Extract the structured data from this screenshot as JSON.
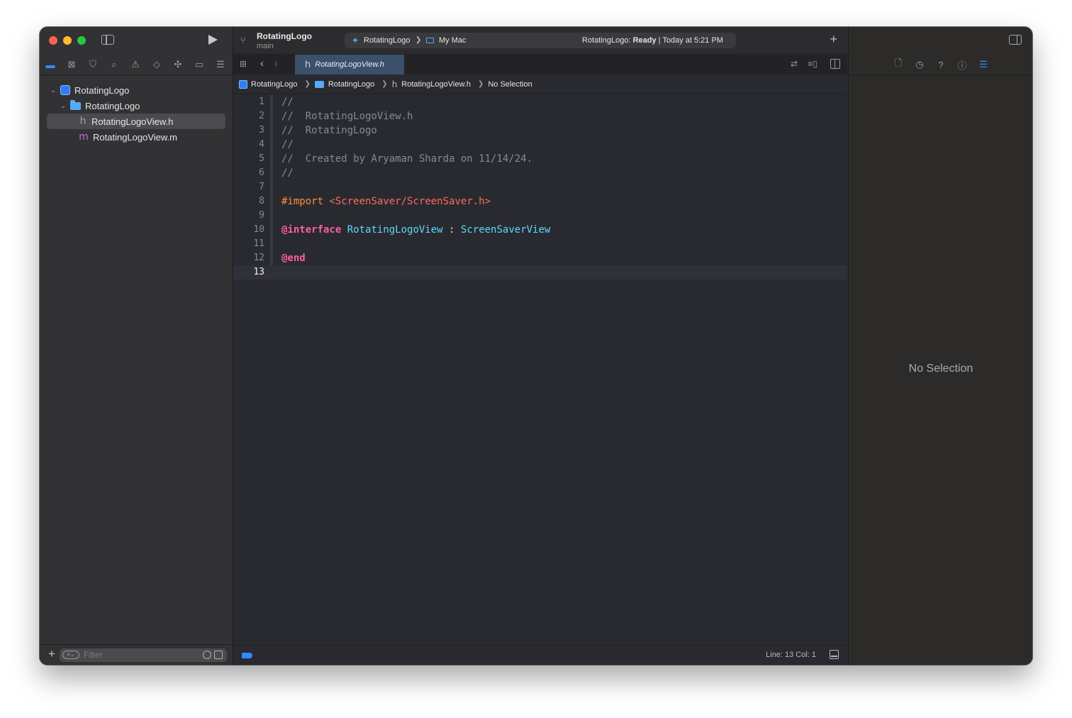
{
  "window": {
    "project_name": "RotatingLogo",
    "branch": "main"
  },
  "sidebar": {
    "nav_icons": [
      {
        "name": "project-navigator-icon",
        "glyph": "▬",
        "active": true
      },
      {
        "name": "source-control-navigator-icon",
        "glyph": "⊠",
        "active": false
      },
      {
        "name": "bookmark-navigator-icon",
        "glyph": "⛉",
        "active": false
      },
      {
        "name": "find-navigator-icon",
        "glyph": "⌕",
        "active": false
      },
      {
        "name": "issue-navigator-icon",
        "glyph": "⚠",
        "active": false
      },
      {
        "name": "test-navigator-icon",
        "glyph": "◇",
        "active": false
      },
      {
        "name": "debug-navigator-icon",
        "glyph": "✣",
        "active": false
      },
      {
        "name": "breakpoint-navigator-icon",
        "glyph": "▭",
        "active": false
      },
      {
        "name": "report-navigator-icon",
        "glyph": "☰",
        "active": false
      }
    ],
    "tree": {
      "project": "RotatingLogo",
      "group": "RotatingLogo",
      "files": [
        {
          "name": "RotatingLogoView.h",
          "type_glyph": "h",
          "selected": true
        },
        {
          "name": "RotatingLogoView.m",
          "type_glyph": "m",
          "selected": false
        }
      ]
    },
    "filter_placeholder": "Filter"
  },
  "toolbar": {
    "scheme": "RotatingLogo",
    "destination": "My Mac",
    "status_prefix": "RotatingLogo: ",
    "status_state": "Ready",
    "status_suffix": " | Today at 5:21 PM"
  },
  "tab": {
    "file_glyph": "h",
    "label": "RotatingLogoView.h"
  },
  "jumpbar": {
    "project": "RotatingLogo",
    "group": "RotatingLogo",
    "file": "RotatingLogoView.h",
    "symbol": "No Selection"
  },
  "code": {
    "lines": [
      {
        "n": "1",
        "text": "//"
      },
      {
        "n": "2",
        "text": "//  RotatingLogoView.h"
      },
      {
        "n": "3",
        "text": "//  RotatingLogo"
      },
      {
        "n": "4",
        "text": "//"
      },
      {
        "n": "5",
        "text": "//  Created by Aryaman Sharda on 11/14/24."
      },
      {
        "n": "6",
        "text": "//"
      },
      {
        "n": "7",
        "text": ""
      },
      {
        "n": "8",
        "directive": "#import",
        "path": "<ScreenSaver/ScreenSaver.h>"
      },
      {
        "n": "9",
        "text": ""
      },
      {
        "n": "10",
        "keyword": "@interface",
        "class": "RotatingLogoView",
        "colon": ":",
        "superclass": "ScreenSaverView"
      },
      {
        "n": "11",
        "text": ""
      },
      {
        "n": "12",
        "end_keyword": "@end"
      },
      {
        "n": "13",
        "text": "",
        "current": true
      }
    ]
  },
  "editor_status": {
    "line_col": "Line: 13  Col: 1"
  },
  "inspector": {
    "tabs": [
      {
        "name": "file-inspector-icon",
        "glyph": "🗋",
        "active": false
      },
      {
        "name": "history-inspector-icon",
        "glyph": "◷",
        "active": false
      },
      {
        "name": "quick-help-inspector-icon",
        "glyph": "?",
        "active": false
      },
      {
        "name": "accessibility-inspector-icon",
        "glyph": "ⓘ",
        "active": false
      },
      {
        "name": "attributes-inspector-icon",
        "glyph": "☰",
        "active": true
      }
    ],
    "empty_label": "No Selection"
  },
  "colors": {
    "accent": "#2f8cff",
    "comment": "#7f8c98",
    "preprocessor": "#fd8f3f",
    "string": "#fc6a5d",
    "keyword": "#fc5fa3",
    "type": "#5dd8ff"
  }
}
